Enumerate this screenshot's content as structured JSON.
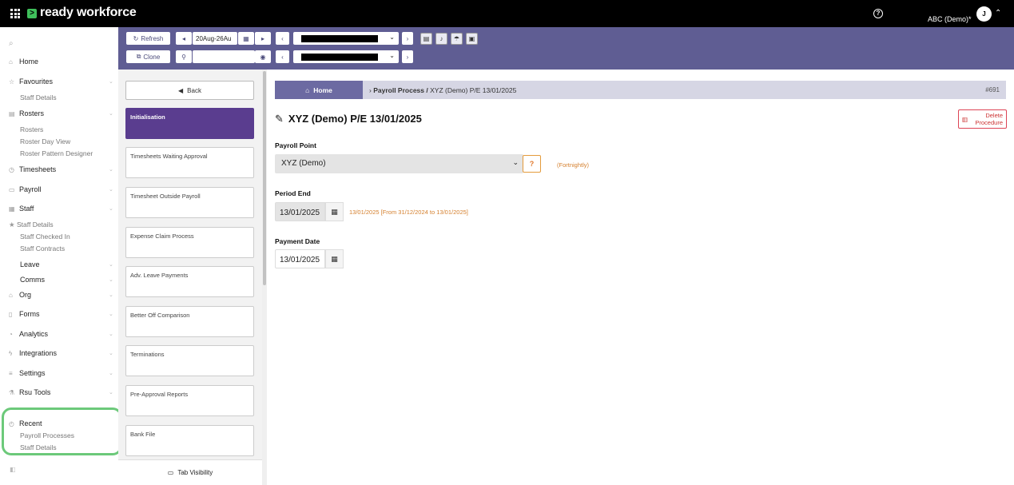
{
  "brand": {
    "name": "ready workforce",
    "mark": ">"
  },
  "header": {
    "org_name": "ABC (Demo)*",
    "avatar_initial": "J"
  },
  "sidebar": {
    "search_placeholder": "",
    "items": [
      {
        "label": "Home",
        "icon": "home-icon",
        "sub": []
      },
      {
        "label": "Favourites",
        "icon": "star-icon",
        "sub": [
          "Staff Details"
        ]
      },
      {
        "label": "Rosters",
        "icon": "calendar-icon",
        "sub": [
          "Rosters",
          "Roster Day View",
          "Roster Pattern Designer"
        ]
      },
      {
        "label": "Timesheets",
        "icon": "clock-icon",
        "sub": []
      },
      {
        "label": "Payroll",
        "icon": "wallet-icon",
        "sub": []
      },
      {
        "label": "Staff",
        "icon": "people-icon",
        "sub": [
          "Staff Details",
          "Staff Checked In",
          "Staff Contracts"
        ]
      },
      {
        "label": "Leave",
        "icon": "",
        "sub": []
      },
      {
        "label": "Comms",
        "icon": "",
        "sub": []
      },
      {
        "label": "Org",
        "icon": "building-icon",
        "sub": []
      },
      {
        "label": "Forms",
        "icon": "document-icon",
        "sub": []
      },
      {
        "label": "Analytics",
        "icon": "chart-icon",
        "sub": []
      },
      {
        "label": "Integrations",
        "icon": "plug-icon",
        "sub": []
      },
      {
        "label": "Settings",
        "icon": "sliders-icon",
        "sub": []
      },
      {
        "label": "Rsu Tools",
        "icon": "flask-icon",
        "sub": []
      }
    ],
    "recent": {
      "label": "Recent",
      "sub": [
        "Payroll Processes",
        "Staff Details"
      ]
    }
  },
  "toolbar": {
    "refresh_label": "Refresh",
    "clone_label": "Clone",
    "date_range": "20Aug-26Au",
    "search_value": ""
  },
  "steps": {
    "back_label": "Back",
    "items": [
      {
        "label": "Initialisation",
        "active": true
      },
      {
        "label": "Timesheets Waiting Approval",
        "active": false
      },
      {
        "label": "Timesheet Outside Payroll",
        "active": false
      },
      {
        "label": "Expense Claim Process",
        "active": false
      },
      {
        "label": "Adv. Leave Payments",
        "active": false
      },
      {
        "label": "Better Off Comparison",
        "active": false
      },
      {
        "label": "Terminations",
        "active": false
      },
      {
        "label": "Pre-Approval Reports",
        "active": false
      },
      {
        "label": "Bank File",
        "active": false
      }
    ],
    "tab_visibility_label": "Tab Visibility"
  },
  "breadcrumb": {
    "home": "Home",
    "section": "Payroll Process /",
    "current": "XYZ (Demo) P/E 13/01/2025",
    "id": "#691"
  },
  "main": {
    "title": "XYZ (Demo) P/E 13/01/2025",
    "delete_label_1": "Delete",
    "delete_label_2": "Procedure",
    "payroll_point_label": "Payroll Point",
    "payroll_point_value": "XYZ (Demo)",
    "payroll_point_help": "?",
    "frequency_note": "(Fortnightly)",
    "period_end_label": "Period End",
    "period_end_value": "13/01/2025",
    "period_end_note": "13/01/2025 [From 31/12/2024 to 13/01/2025]",
    "payment_date_label": "Payment Date",
    "payment_date_value": "13/01/2025"
  },
  "colors": {
    "accent": "#5f5d93",
    "active_step": "#5a3d8f",
    "highlight": "#6cc97a",
    "warning": "#d5802f"
  }
}
